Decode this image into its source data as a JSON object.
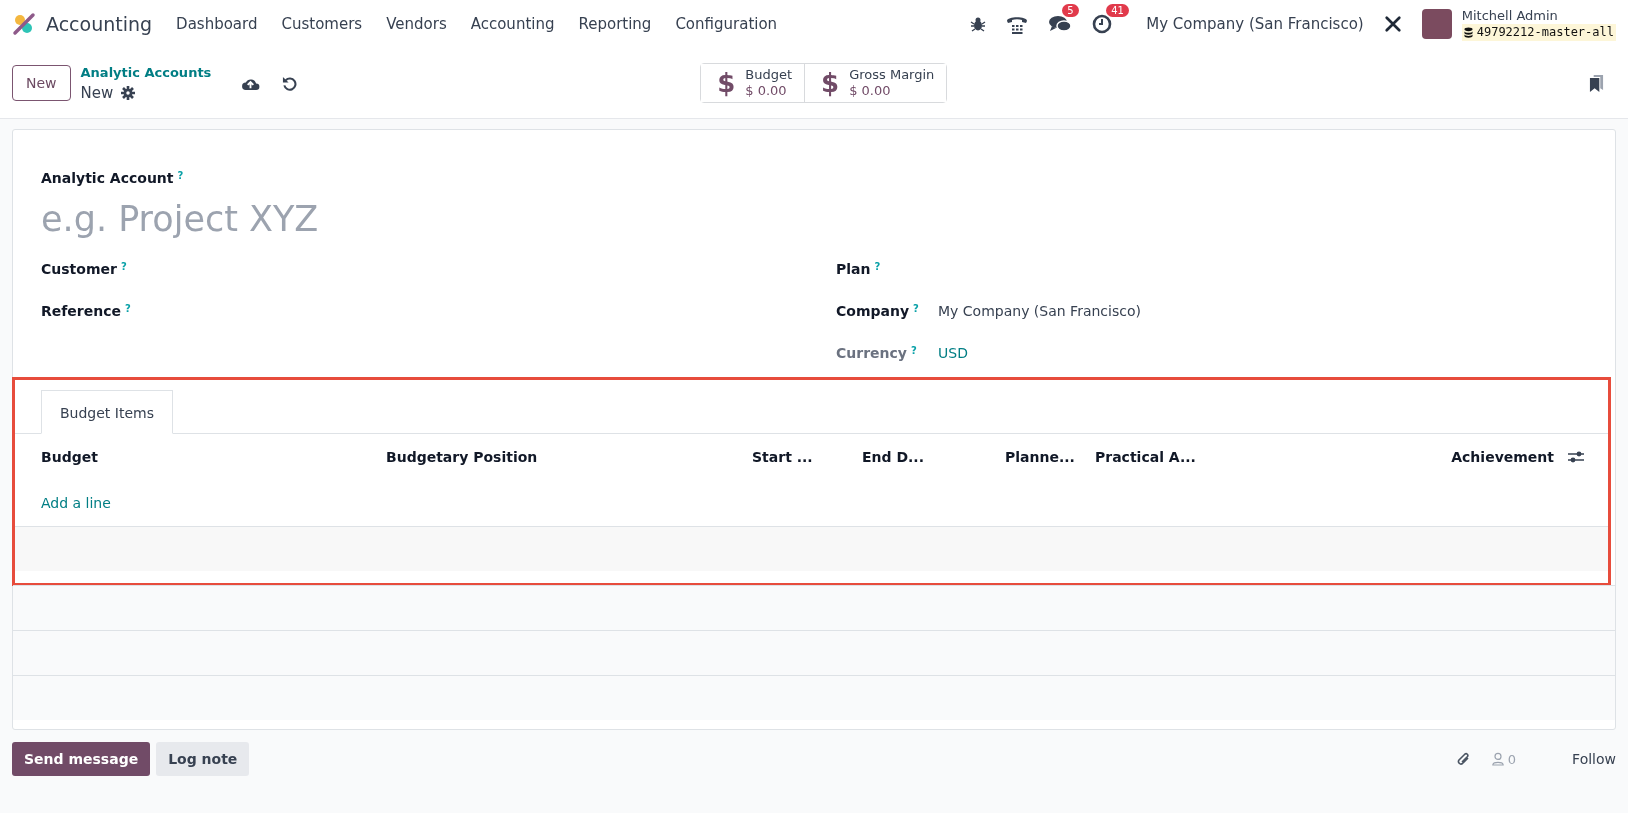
{
  "navbar": {
    "app_name": "Accounting",
    "menu": [
      "Dashboard",
      "Customers",
      "Vendors",
      "Accounting",
      "Reporting",
      "Configuration"
    ],
    "messages_count": "5",
    "activities_count": "41",
    "company": "My Company (San Francisco)",
    "user": {
      "name": "Mitchell Admin",
      "database": "49792212-master-all"
    }
  },
  "control_panel": {
    "new_button": "New",
    "breadcrumb": "Analytic Accounts",
    "record": "New",
    "stat_buttons": [
      {
        "icon": "$",
        "label": "Budget",
        "value": "$ 0.00"
      },
      {
        "icon": "$",
        "label": "Gross Margin",
        "value": "$ 0.00"
      }
    ]
  },
  "form": {
    "name_label": "Analytic Account",
    "name_help": "?",
    "name_placeholder": "e.g. Project XYZ",
    "left_fields": [
      {
        "label": "Customer",
        "help": "?",
        "readonly": false
      },
      {
        "label": "Reference",
        "help": "?",
        "readonly": false
      }
    ],
    "right_fields": [
      {
        "label": "Plan",
        "help": "?",
        "readonly": false
      },
      {
        "label": "Company",
        "help": "?",
        "value": "My Company (San Francisco)",
        "readonly": false
      },
      {
        "label": "Currency",
        "help": "?",
        "value": "USD",
        "readonly": true
      }
    ],
    "notebook": {
      "highlighted": true,
      "tabs": [
        {
          "label": "Budget Items",
          "selected": true
        }
      ],
      "columns": [
        "Budget",
        "Budgetary Position",
        "Start ...",
        "End D...",
        "Planne...",
        "Practical A...",
        "Achievement"
      ],
      "add_line": "Add a line"
    }
  },
  "chatter": {
    "buttons": [
      {
        "label": "Send message",
        "kind": "primary"
      },
      {
        "label": "Log note",
        "kind": "secondary"
      }
    ],
    "followers": "0",
    "follow": "Follow"
  }
}
